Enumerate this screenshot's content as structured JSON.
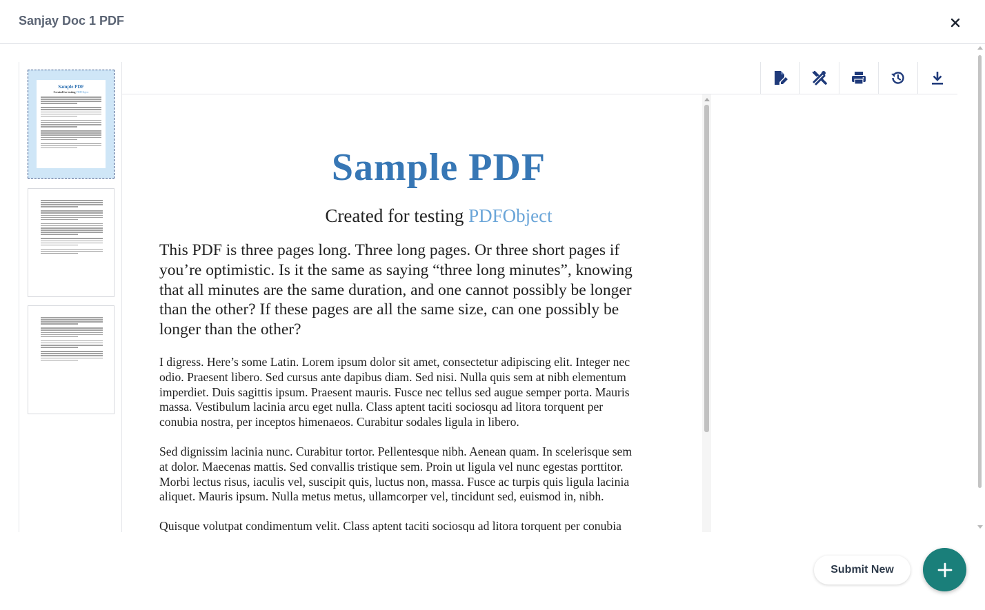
{
  "header": {
    "title": "Sanjay Doc 1 PDF",
    "close_icon": "close-icon"
  },
  "thumbnails": {
    "pages": [
      {
        "page": 1,
        "active": true,
        "title": "Sample PDF",
        "subtitle_prefix": "Created for testing ",
        "subtitle_link": "PDFObject"
      },
      {
        "page": 2,
        "active": false
      },
      {
        "page": 3,
        "active": false
      }
    ]
  },
  "toolbar": {
    "buttons": [
      {
        "name": "edit-document-button",
        "icon": "edit-document-icon"
      },
      {
        "name": "tools-button",
        "icon": "tools-icon"
      },
      {
        "name": "print-button",
        "icon": "print-icon"
      },
      {
        "name": "history-button",
        "icon": "history-icon"
      },
      {
        "name": "download-button",
        "icon": "download-icon"
      }
    ]
  },
  "pdf": {
    "title": "Sample PDF",
    "subtitle_prefix": "Created for testing ",
    "subtitle_link": "PDFObject",
    "lead_lines": [
      "This PDF is three pages long. Three long pages. Or three short pages if",
      "you’re optimistic. Is it the same as saying “three long minutes”, knowing",
      "that all minutes are the same duration, and one cannot possibly be longer",
      "than the other? If these pages are all the same size, can one possibly be",
      "longer than the other?"
    ],
    "para1_lines": [
      "I digress. Here’s some Latin. Lorem ipsum dolor sit amet, consectetur adipiscing elit. Integer nec",
      "odio. Praesent libero. Sed cursus ante dapibus diam. Sed nisi. Nulla quis sem at nibh elementum",
      "imperdiet. Duis sagittis ipsum. Praesent mauris. Fusce nec tellus sed augue semper porta. Mauris",
      "massa. Vestibulum lacinia arcu eget nulla. Class aptent taciti sociosqu ad litora torquent per",
      "conubia nostra, per inceptos himenaeos. Curabitur sodales ligula in libero."
    ],
    "para2_lines": [
      "Sed dignissim lacinia nunc. Curabitur tortor. Pellentesque nibh. Aenean quam. In scelerisque sem",
      "at dolor. Maecenas mattis. Sed convallis tristique sem. Proin ut ligula vel nunc egestas porttitor.",
      "Morbi lectus risus, iaculis vel, suscipit quis, luctus non, massa. Fusce ac turpis quis ligula lacinia",
      "aliquet. Mauris ipsum. Nulla metus metus, ullamcorper vel, tincidunt sed, euismod in, nibh."
    ],
    "para3_lines": [
      "Quisque volutpat condimentum velit. Class aptent taciti sociosqu ad litora torquent per conubia"
    ]
  },
  "actions": {
    "submit_label": "Submit New",
    "fab_icon": "plus-icon"
  },
  "colors": {
    "accent": "#1a7f7a",
    "icon": "#1f3a7a",
    "pdf_title": "#3777b5",
    "pdf_link": "#6aa5d8"
  }
}
